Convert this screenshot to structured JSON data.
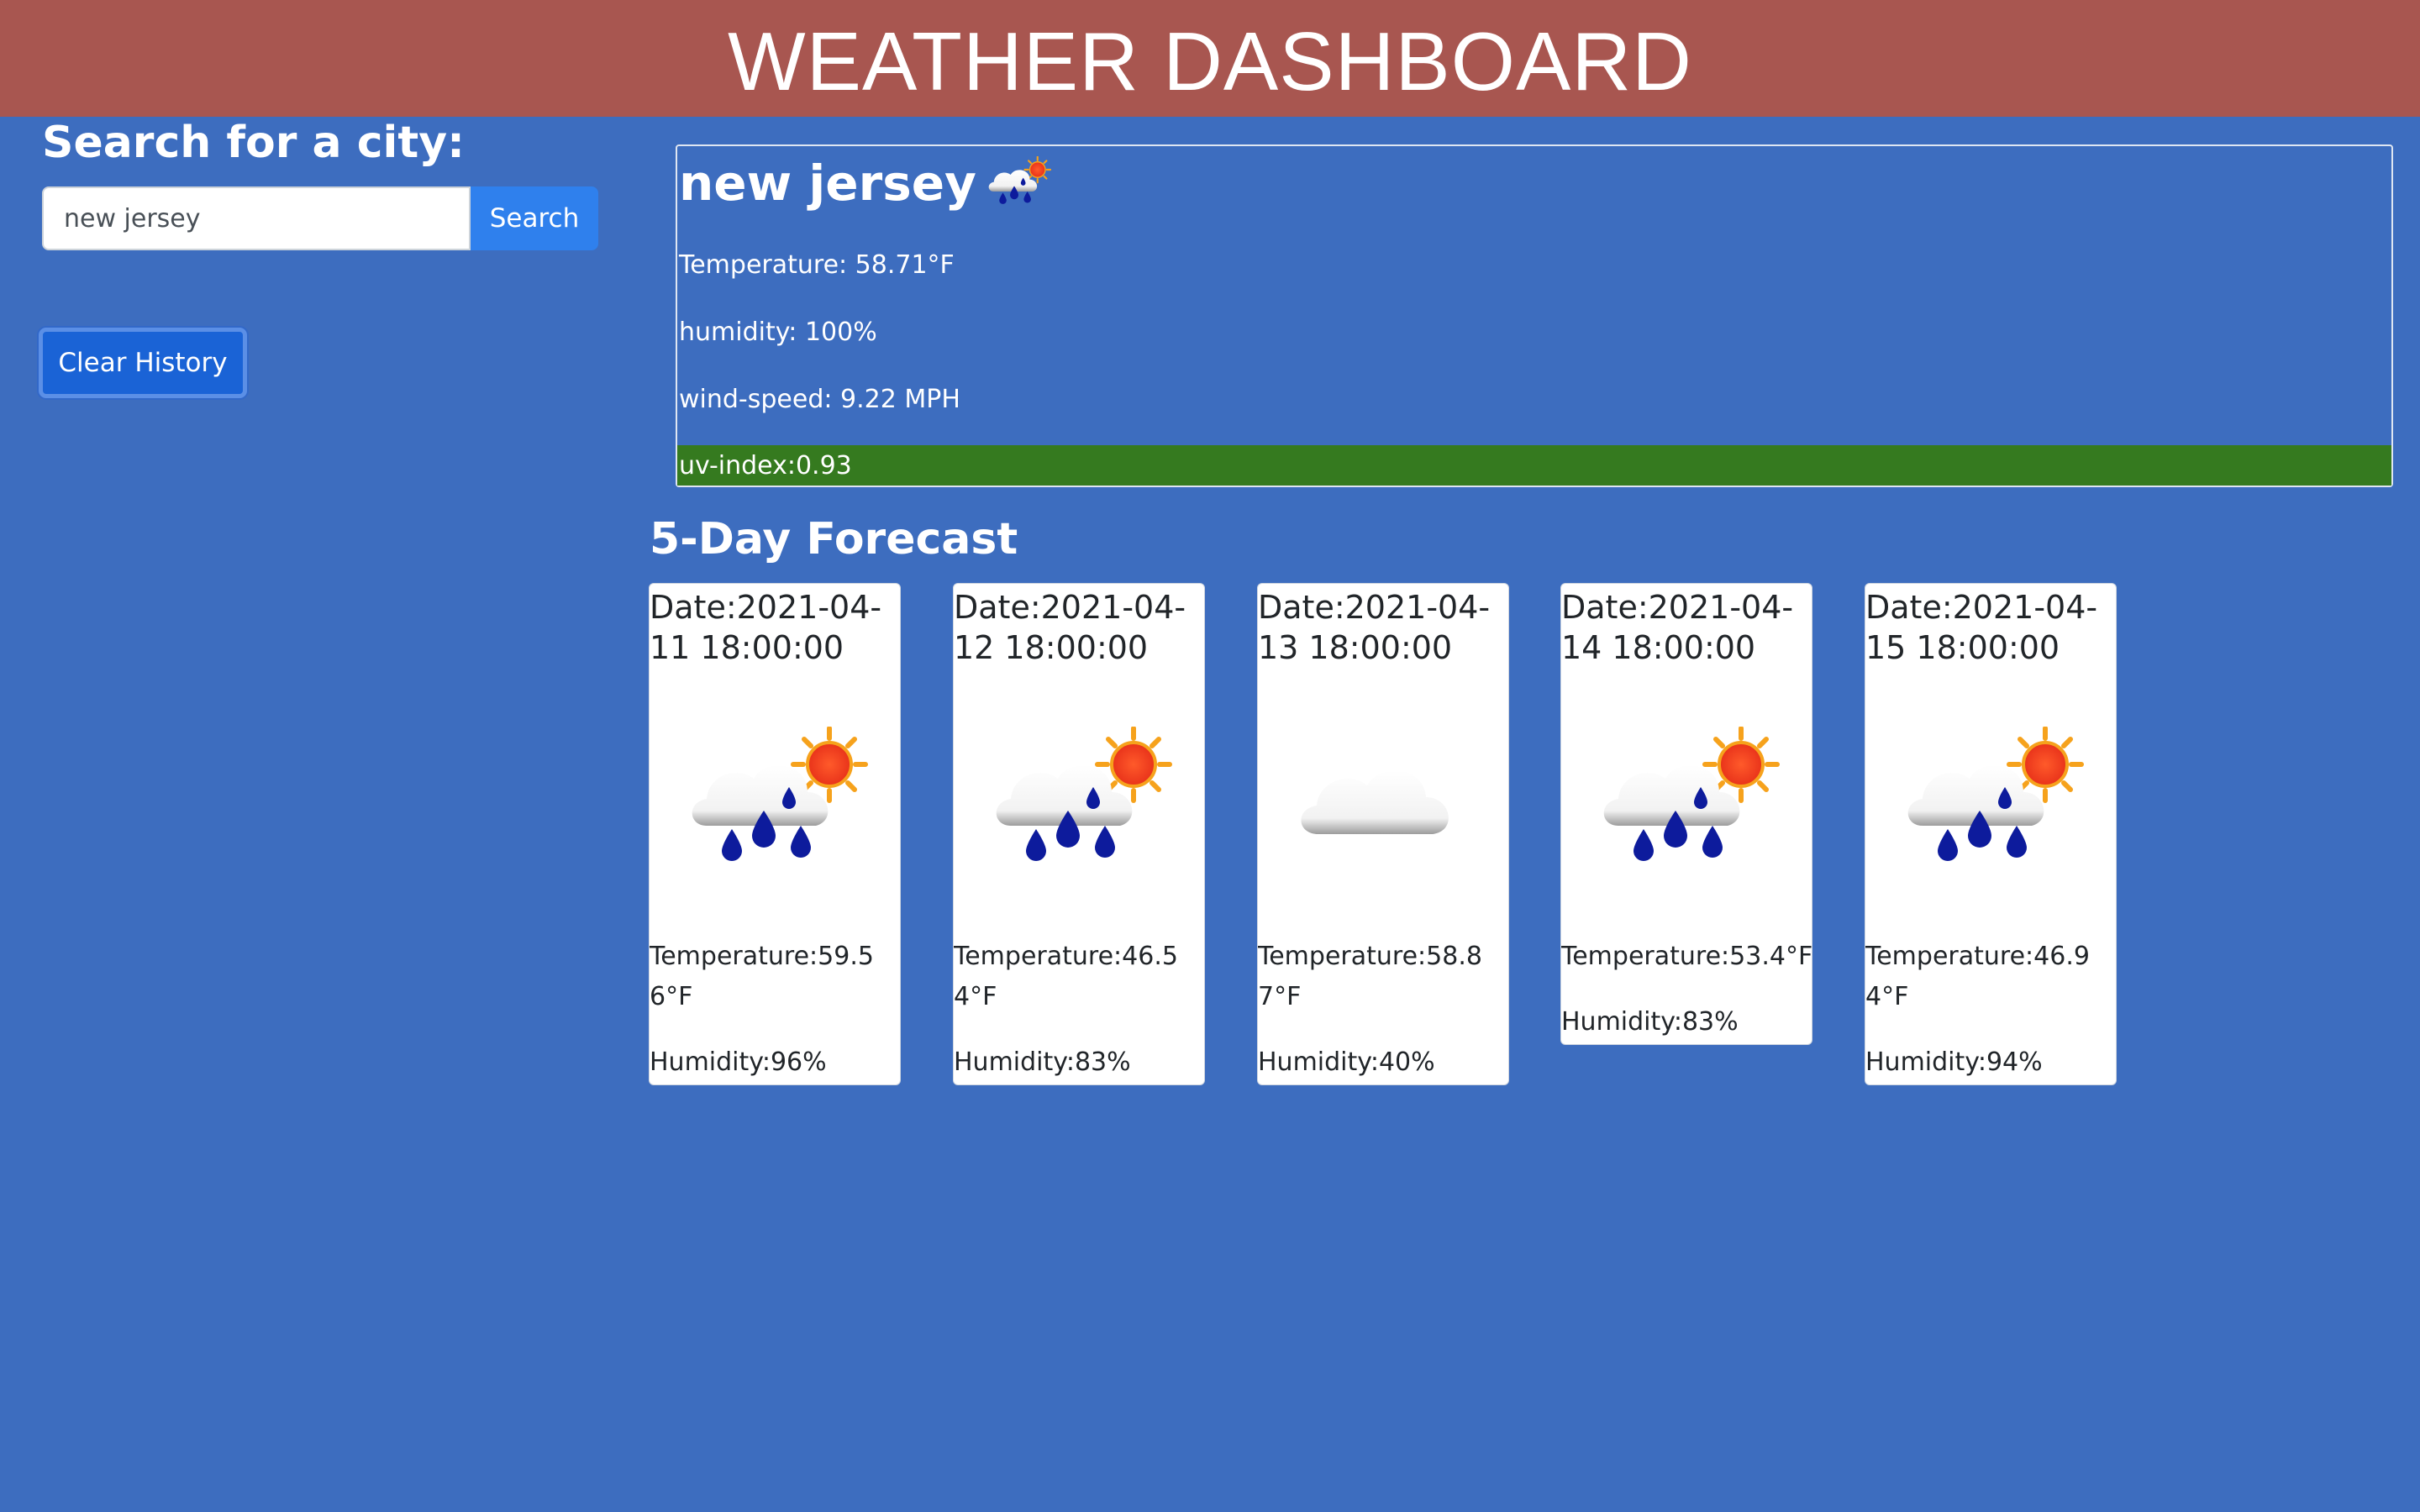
{
  "header": {
    "title": "WEATHER DASHBOARD"
  },
  "search": {
    "title": "Search for a city:",
    "input_value": "new jersey",
    "button_label": "Search"
  },
  "history": {
    "clear_label": "Clear History"
  },
  "current": {
    "city": "new jersey",
    "icon": "rain-sun-icon",
    "temperature": "Temperature: 58.71°F",
    "humidity": "humidity: 100%",
    "wind": "wind-speed: 9.22 MPH",
    "uv": "uv-index:0.93",
    "uv_color": "#357a1f"
  },
  "forecast": {
    "title": "5-Day Forecast",
    "days": [
      {
        "date": "Date:2021-04-11 18:00:00",
        "icon": "rain-sun-icon",
        "temp": "Temperature:59.56°F",
        "humidity": "Humidity:96%"
      },
      {
        "date": "Date:2021-04-12 18:00:00",
        "icon": "rain-sun-icon",
        "temp": "Temperature:46.54°F",
        "humidity": "Humidity:83%"
      },
      {
        "date": "Date:2021-04-13 18:00:00",
        "icon": "cloud-icon",
        "temp": "Temperature:58.87°F",
        "humidity": "Humidity:40%"
      },
      {
        "date": "Date:2021-04-14 18:00:00",
        "icon": "rain-sun-icon",
        "temp": "Temperature:53.4°F",
        "humidity": "Humidity:83%"
      },
      {
        "date": "Date:2021-04-15 18:00:00",
        "icon": "rain-sun-icon",
        "temp": "Temperature:46.94°F",
        "humidity": "Humidity:94%"
      }
    ]
  },
  "colors": {
    "background": "#3d6dbf",
    "header": "#a85650",
    "primary_button": "#2f80ed"
  }
}
